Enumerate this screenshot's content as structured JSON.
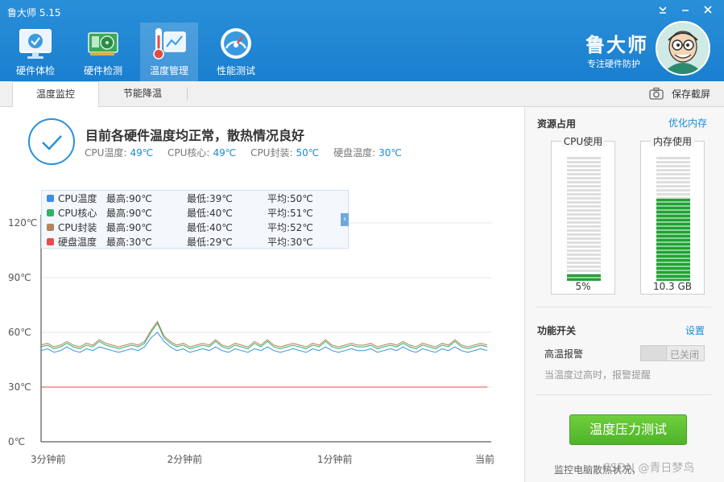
{
  "app": {
    "title": "鲁大师 5.15",
    "brand": "鲁大师",
    "brand_sub": "专注硬件防护"
  },
  "nav": [
    {
      "label": "硬件体检",
      "icon": "monitor-check-icon",
      "active": false
    },
    {
      "label": "硬件检测",
      "icon": "graphics-card-icon",
      "active": false
    },
    {
      "label": "温度管理",
      "icon": "thermometer-chart-icon",
      "active": true
    },
    {
      "label": "性能测试",
      "icon": "speedometer-icon",
      "active": false
    }
  ],
  "tabs": [
    {
      "label": "温度监控",
      "active": true
    },
    {
      "label": "节能降温",
      "active": false
    }
  ],
  "save_screenshot": "保存截屏",
  "status": {
    "title": "目前各硬件温度均正常，散热情况良好",
    "items": [
      {
        "label": "CPU温度:",
        "value": "49℃"
      },
      {
        "label": "CPU核心:",
        "value": "49℃"
      },
      {
        "label": "CPU封装:",
        "value": "50℃"
      },
      {
        "label": "硬盘温度:",
        "value": "30℃"
      }
    ]
  },
  "legend": [
    {
      "name": "CPU温度",
      "max": "最高:90℃",
      "min": "最低:39℃",
      "avg": "平均:50℃",
      "color": "#3a8ee6"
    },
    {
      "name": "CPU核心",
      "max": "最高:90℃",
      "min": "最低:40℃",
      "avg": "平均:51℃",
      "color": "#2eb36b"
    },
    {
      "name": "CPU封装",
      "max": "最高:90℃",
      "min": "最低:40℃",
      "avg": "平均:52℃",
      "color": "#b5825c"
    },
    {
      "name": "硬盘温度",
      "max": "最高:30℃",
      "min": "最低:29℃",
      "avg": "平均:30℃",
      "color": "#e84a4a"
    }
  ],
  "chart_data": {
    "type": "line",
    "y_ticks": [
      "120℃",
      "90℃",
      "60℃",
      "30℃",
      "0℃"
    ],
    "x_ticks": [
      "3分钟前",
      "2分钟前",
      "1分钟前",
      "当前"
    ],
    "ylim": [
      0,
      120
    ],
    "series": [
      {
        "name": "CPU温度",
        "color": "#3a8ee6",
        "values": [
          50,
          51,
          49,
          50,
          52,
          50,
          49,
          51,
          50,
          52,
          51,
          50,
          49,
          50,
          51,
          50,
          52,
          57,
          60,
          55,
          52,
          50,
          51,
          49,
          50,
          51,
          50,
          52,
          50,
          49,
          51,
          50,
          49,
          51,
          50,
          52,
          50,
          49,
          50,
          51,
          50,
          49,
          51,
          50,
          52,
          50,
          49,
          50,
          51,
          50,
          50,
          51,
          49,
          50,
          51,
          50,
          52,
          50,
          49,
          51,
          50,
          49,
          51,
          50,
          52,
          50,
          49,
          50,
          51,
          50
        ]
      },
      {
        "name": "CPU核心",
        "color": "#2eb36b",
        "values": [
          52,
          53,
          51,
          52,
          54,
          52,
          51,
          53,
          52,
          55,
          53,
          52,
          51,
          52,
          53,
          52,
          54,
          60,
          65,
          57,
          54,
          52,
          53,
          51,
          52,
          53,
          52,
          55,
          52,
          51,
          53,
          52,
          51,
          54,
          52,
          55,
          52,
          51,
          52,
          53,
          52,
          51,
          53,
          52,
          55,
          52,
          51,
          52,
          53,
          52,
          52,
          53,
          51,
          52,
          53,
          52,
          54,
          52,
          51,
          53,
          52,
          51,
          53,
          52,
          55,
          52,
          51,
          52,
          53,
          52
        ]
      },
      {
        "name": "CPU封装",
        "color": "#b5825c",
        "values": [
          53,
          54,
          52,
          53,
          55,
          53,
          52,
          54,
          53,
          56,
          54,
          53,
          52,
          53,
          54,
          53,
          55,
          61,
          66,
          58,
          55,
          53,
          54,
          52,
          53,
          54,
          53,
          56,
          53,
          52,
          54,
          53,
          52,
          55,
          53,
          56,
          53,
          52,
          53,
          54,
          53,
          52,
          54,
          53,
          56,
          53,
          52,
          53,
          54,
          53,
          53,
          54,
          52,
          53,
          54,
          53,
          55,
          53,
          52,
          54,
          53,
          52,
          54,
          53,
          56,
          53,
          52,
          53,
          54,
          53
        ]
      },
      {
        "name": "硬盘温度",
        "color": "#e84a4a",
        "values": [
          30,
          30,
          30,
          30,
          30,
          30,
          30,
          30,
          30,
          30,
          30,
          30,
          30,
          30,
          30,
          30,
          30,
          30,
          30,
          30,
          30,
          30,
          30,
          30,
          30,
          30,
          30,
          30,
          30,
          30,
          30,
          30,
          30,
          30,
          30,
          30,
          30,
          30,
          30,
          30,
          30,
          30,
          30,
          30,
          30,
          30,
          30,
          30,
          30,
          30,
          30,
          30,
          30,
          30,
          30,
          30,
          30,
          30,
          30,
          30,
          30,
          30,
          30,
          30,
          30,
          30,
          30,
          30,
          30,
          30
        ]
      }
    ]
  },
  "resources": {
    "title": "资源占用",
    "optimize_link": "优化内存",
    "cpu": {
      "label": "CPU使用",
      "value": "5%",
      "level": 0.05
    },
    "memory": {
      "label": "内存使用",
      "value": "10.3 GB",
      "level": 0.66
    }
  },
  "features": {
    "title": "功能开关",
    "settings_link": "设置",
    "alarm_label": "高温报警",
    "alarm_state": "已关闭",
    "alarm_desc": "当温度过高时，报警提醒"
  },
  "stress_test_button": "温度压力测试",
  "footer_note": "监控电脑散热状况，",
  "watermark": "CSDN @青日梦鸟"
}
